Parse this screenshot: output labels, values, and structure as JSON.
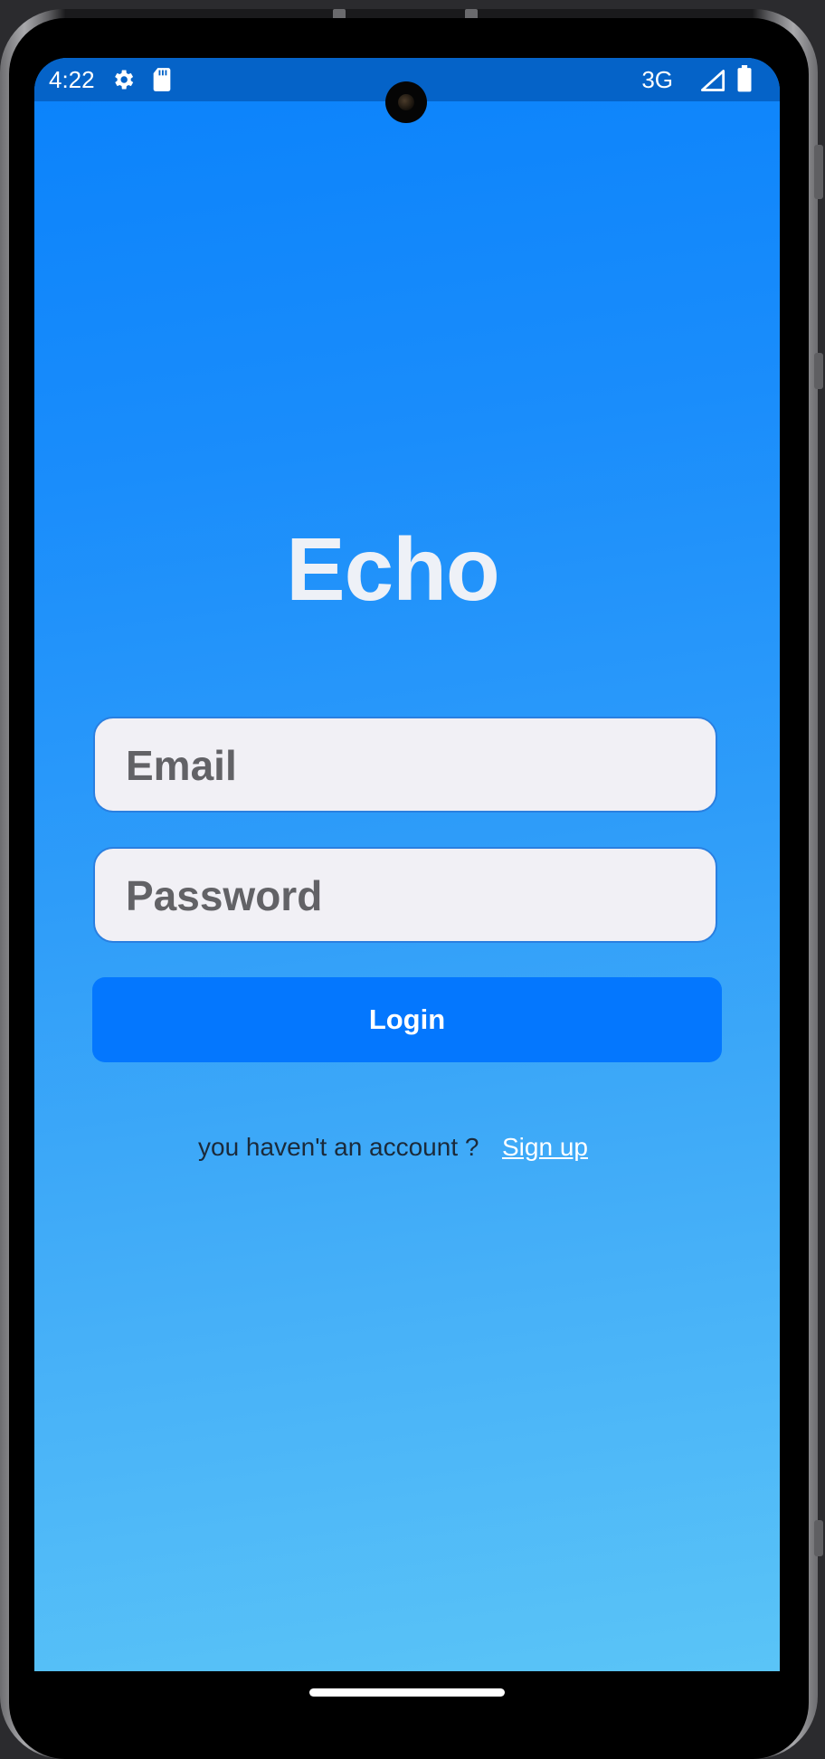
{
  "status_bar": {
    "time": "4:22",
    "network": "3G",
    "icons": [
      "gear-icon",
      "sd-card-icon",
      "signal-icon",
      "battery-icon"
    ]
  },
  "app": {
    "title": "Echo"
  },
  "form": {
    "email_placeholder": "Email",
    "password_placeholder": "Password",
    "login_label": "Login",
    "signup_prompt": "you haven't an account ?",
    "signup_link": "Sign up"
  },
  "colors": {
    "status_bar": "#0563c8",
    "background_top": "#0a82fb",
    "background_bottom": "#5ac4f7",
    "login_button": "#0477fe",
    "field_background": "#f1f0f5",
    "title_text": "#eef1f7"
  }
}
